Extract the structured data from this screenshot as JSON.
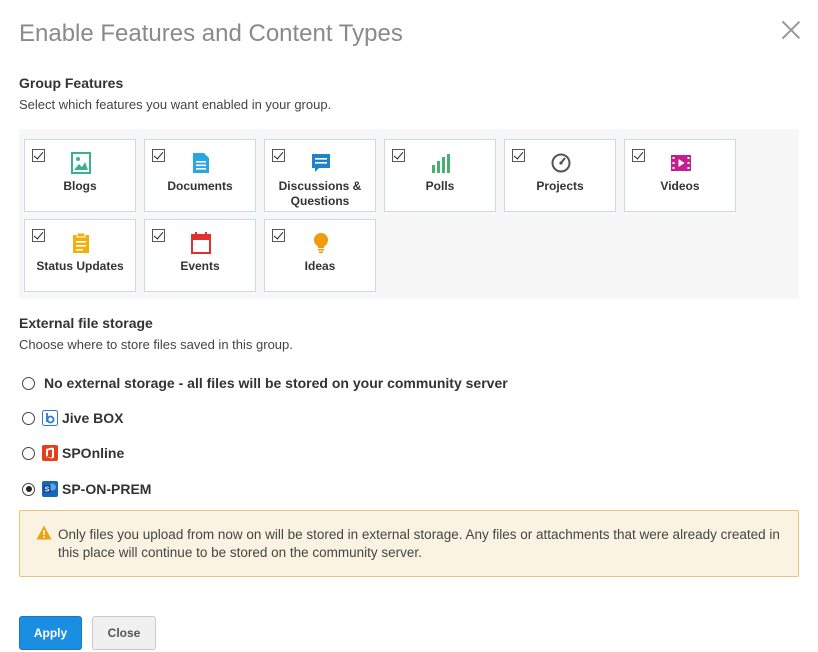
{
  "dialog": {
    "title": "Enable Features and Content Types"
  },
  "group_features": {
    "heading": "Group Features",
    "description": "Select which features you want enabled in your group.",
    "features": [
      {
        "label": "Blogs",
        "checked": true,
        "icon": "blog-image-icon",
        "color": "#3bb38a"
      },
      {
        "label": "Documents",
        "checked": true,
        "icon": "document-icon",
        "color": "#2aa7de"
      },
      {
        "label": "Discussions &\nQuestions",
        "checked": true,
        "icon": "discussion-icon",
        "color": "#1e83c8"
      },
      {
        "label": "Polls",
        "checked": true,
        "icon": "poll-bars-icon",
        "color": "#48b06e"
      },
      {
        "label": "Projects",
        "checked": true,
        "icon": "project-gauge-icon",
        "color": "#555555"
      },
      {
        "label": "Videos",
        "checked": true,
        "icon": "video-icon",
        "color": "#c21f8f"
      },
      {
        "label": "Status Updates",
        "checked": true,
        "icon": "status-update-icon",
        "color": "#f2b10a"
      },
      {
        "label": "Events",
        "checked": true,
        "icon": "calendar-icon",
        "color": "#e0322d"
      },
      {
        "label": "Ideas",
        "checked": true,
        "icon": "lightbulb-icon",
        "color": "#f29a0c"
      }
    ]
  },
  "external_storage": {
    "heading": "External file storage",
    "description": "Choose where to store files saved in this group.",
    "options": [
      {
        "label": "No external storage - all files will be stored on your community server",
        "selected": false,
        "icon": ""
      },
      {
        "label": "Jive BOX",
        "selected": false,
        "icon": "box-icon"
      },
      {
        "label": "SPOnline",
        "selected": false,
        "icon": "office-icon"
      },
      {
        "label": "SP-ON-PREM",
        "selected": true,
        "icon": "sharepoint-icon"
      }
    ]
  },
  "warning": {
    "text": "Only files you upload from now on will be stored in external storage. Any files or attachments that were already created in this place will continue to be stored on the community server.",
    "icon": "warning-triangle-icon"
  },
  "buttons": {
    "apply": "Apply",
    "close": "Close"
  },
  "colors": {
    "primary_button": "#1a8fe2",
    "warning_bg": "#faf3e2",
    "warning_border": "#e8c57f",
    "tile_border": "#c7dceb"
  }
}
